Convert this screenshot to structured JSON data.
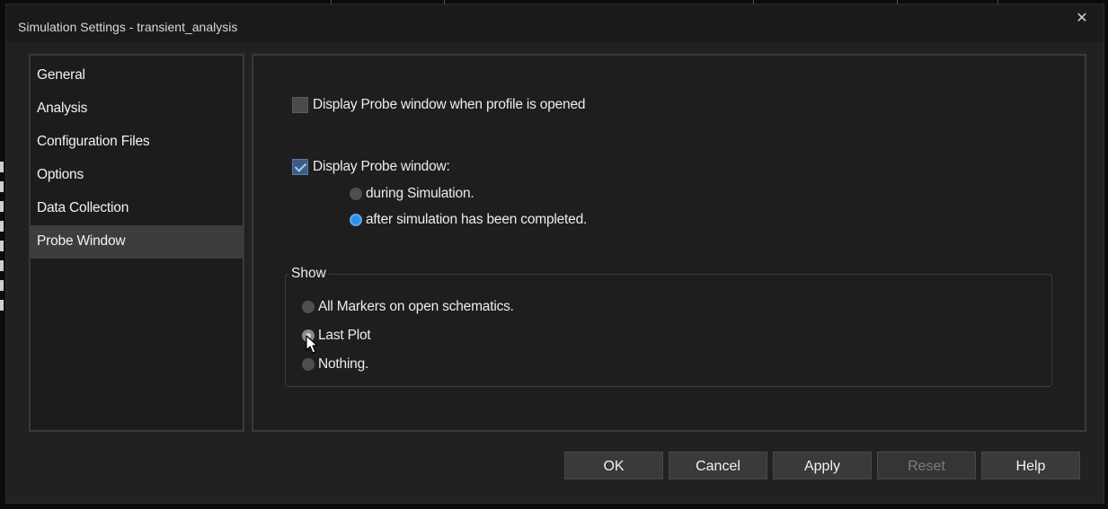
{
  "window": {
    "title": "Simulation Settings - transient_analysis",
    "close_glyph": "✕"
  },
  "sidebar": {
    "items": [
      {
        "label": "General"
      },
      {
        "label": "Analysis"
      },
      {
        "label": "Configuration Files"
      },
      {
        "label": "Options"
      },
      {
        "label": "Data Collection"
      },
      {
        "label": "Probe Window",
        "active": true
      }
    ]
  },
  "probe": {
    "open_profile_label": "Display Probe window when profile is opened",
    "open_profile_checked": false,
    "display_label": "Display Probe window:",
    "display_checked": true,
    "during_label": "during Simulation.",
    "after_label": "after simulation has been completed.",
    "after_selected": true
  },
  "show": {
    "title": "Show",
    "all_markers_label": "All Markers on open schematics.",
    "last_plot_label": "Last Plot",
    "nothing_label": "Nothing."
  },
  "buttons": {
    "ok": "OK",
    "cancel": "Cancel",
    "apply": "Apply",
    "reset": "Reset",
    "help": "Help"
  },
  "colors": {
    "accent": "#2d8fe6",
    "background": "#212121"
  },
  "icons": {
    "close": "close-icon",
    "cursor": "mouse-pointer-icon"
  }
}
